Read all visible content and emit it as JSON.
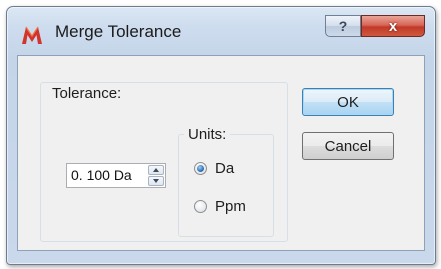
{
  "window": {
    "title": "Merge Tolerance",
    "help_label": "?",
    "close_label": "x",
    "app_icon": "mass-spec-m-icon"
  },
  "tolerance": {
    "group_label": "Tolerance:",
    "value": "0. 100 Da"
  },
  "units": {
    "group_label": "Units:",
    "options": [
      {
        "label": "Da",
        "checked": true
      },
      {
        "label": "Ppm",
        "checked": false
      }
    ]
  },
  "buttons": {
    "ok_label": "OK",
    "cancel_label": "Cancel"
  },
  "colors": {
    "app_icon_red": "#d2332b",
    "close_red": "#c13a28",
    "default_button_border": "#3c7fb1"
  }
}
